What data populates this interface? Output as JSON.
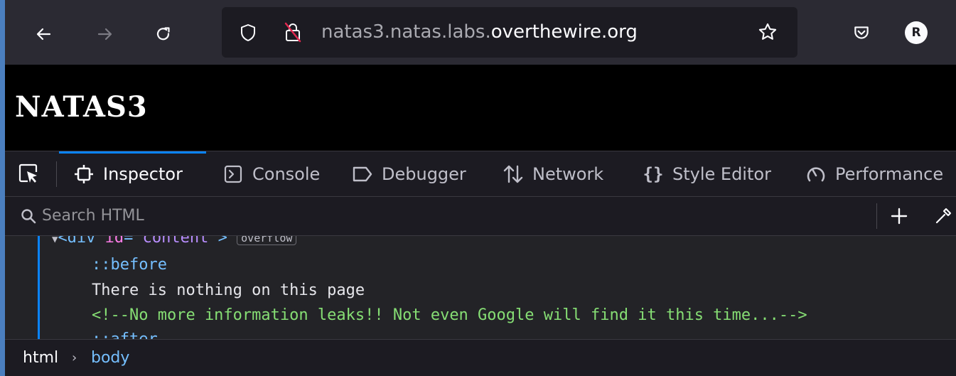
{
  "browser": {
    "url_prefix": "natas3.natas.labs.",
    "url_domain": "overthewire.org",
    "profile_initial": "R"
  },
  "page": {
    "title": "NATAS3"
  },
  "devtools": {
    "tabs": [
      {
        "label": "Inspector",
        "icon": "inspector-icon",
        "active": true
      },
      {
        "label": "Console",
        "icon": "console-icon"
      },
      {
        "label": "Debugger",
        "icon": "debugger-icon"
      },
      {
        "label": "Network",
        "icon": "network-icon"
      },
      {
        "label": "Style Editor",
        "icon": "style-editor-icon"
      },
      {
        "label": "Performance",
        "icon": "performance-icon"
      }
    ],
    "search_placeholder": "Search HTML",
    "markup": {
      "div_tag_open": "<div",
      "div_attr_name": "id",
      "div_attr_eq": "=\"",
      "div_attr_value": "content",
      "div_attr_close": "\">",
      "overflow_badge": "overflow",
      "pseudo_before": "::before",
      "text_node": "There is nothing on this page",
      "comment": "<!--No more information leaks!! Not even Google will find it this time...-->",
      "pseudo_after": "::after"
    },
    "breadcrumbs": [
      "html",
      "body"
    ]
  },
  "colors": {
    "accent": "#0a84ff",
    "comment": "#86de74",
    "tag": "#75bfff",
    "attribute": "#ff7de9",
    "attribute_value": "#b98eff"
  }
}
